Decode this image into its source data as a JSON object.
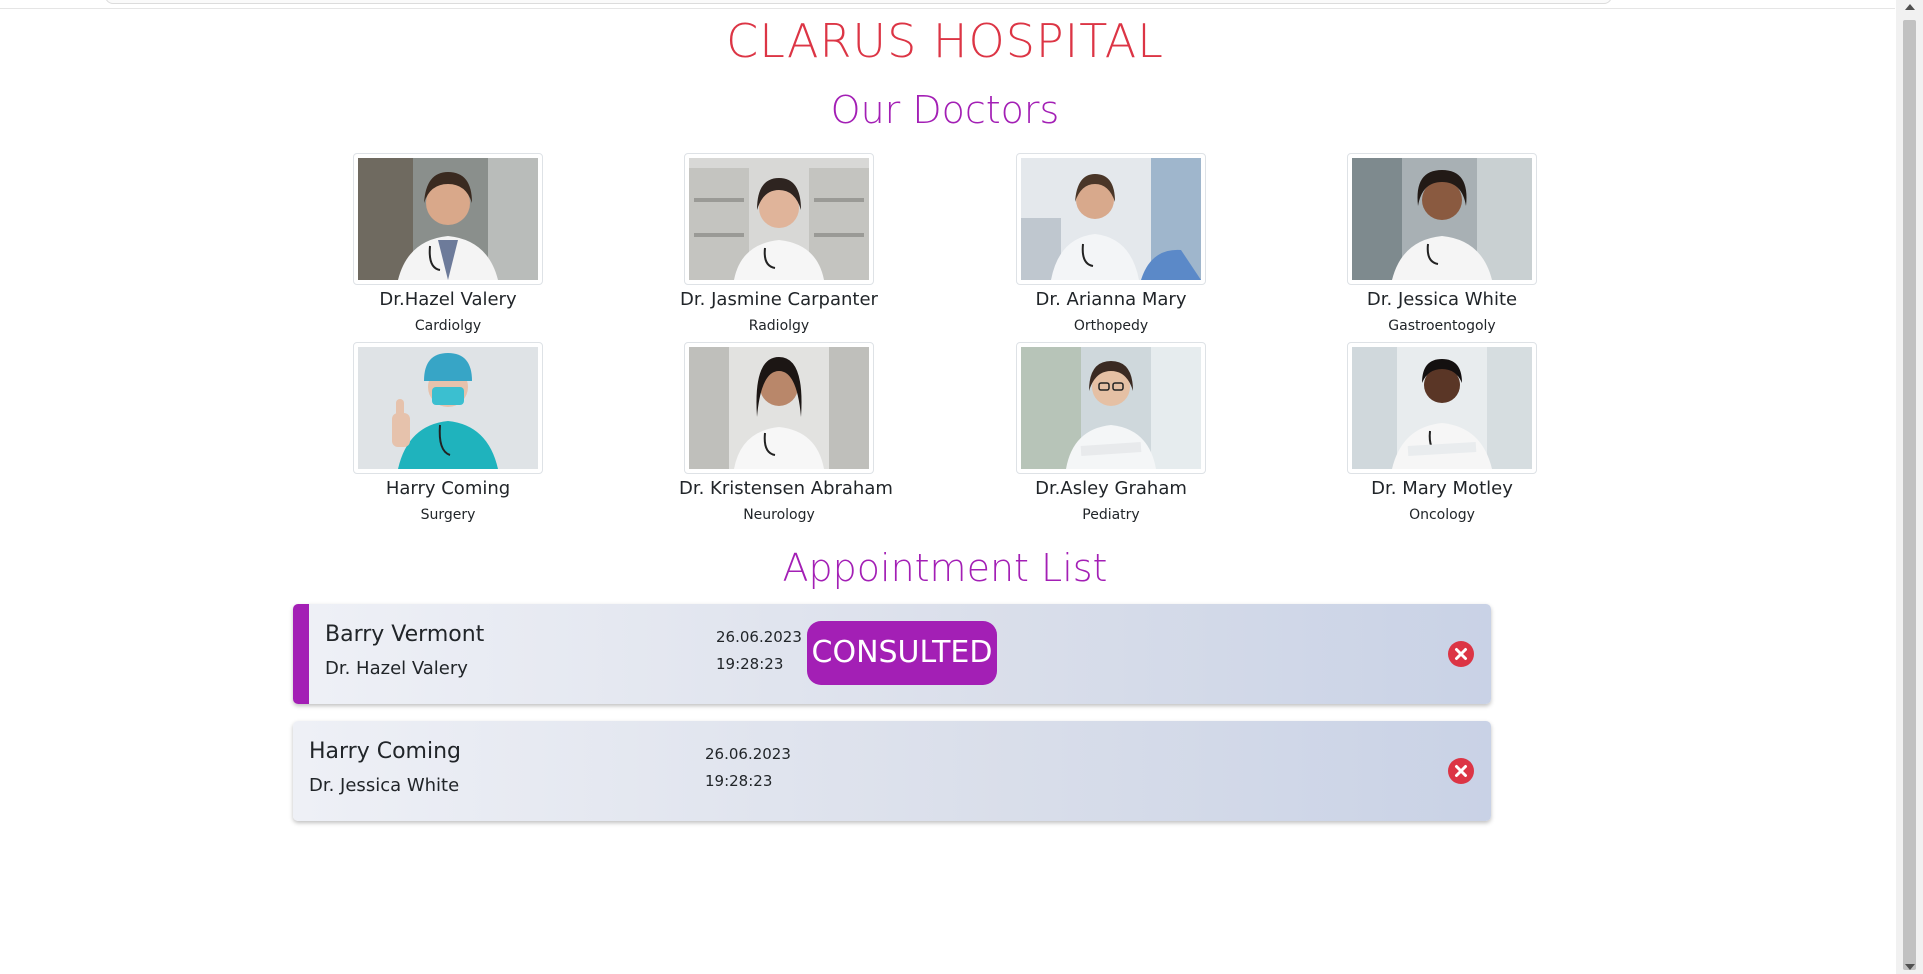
{
  "header": {
    "title": "CLARUS HOSPITAL"
  },
  "doctors_section": {
    "title": "Our Doctors",
    "doctors": [
      {
        "name": "Dr.Hazel Valery",
        "specialty": "Cardiolgy"
      },
      {
        "name": "Dr. Jasmine Carpanter",
        "specialty": "Radiolgy"
      },
      {
        "name": "Dr. Arianna Mary",
        "specialty": "Orthopedy"
      },
      {
        "name": "Dr. Jessica White",
        "specialty": "Gastroentogoly"
      },
      {
        "name": "Harry Coming",
        "specialty": "Surgery"
      },
      {
        "name": "Dr. Kristensen Abraham",
        "specialty": "Neurology"
      },
      {
        "name": "Dr.Asley Graham",
        "specialty": "Pediatry"
      },
      {
        "name": "Dr. Mary Motley",
        "specialty": "Oncology"
      }
    ]
  },
  "appointments_section": {
    "title": "Appointment List",
    "appointments": [
      {
        "patient": "Barry Vermont",
        "doctor": "Dr. Hazel Valery",
        "date": "26.06.2023",
        "time": "19:28:23",
        "status": "CONSULTED"
      },
      {
        "patient": "Harry Coming",
        "doctor": "Dr. Jessica White",
        "date": "26.06.2023",
        "time": "19:28:23",
        "status": ""
      }
    ]
  },
  "colors": {
    "title_red": "#dc3545",
    "accent_purple": "#a31fb5",
    "delete_red": "#dc3545"
  },
  "icons": {
    "delete": "circle-x-icon"
  }
}
